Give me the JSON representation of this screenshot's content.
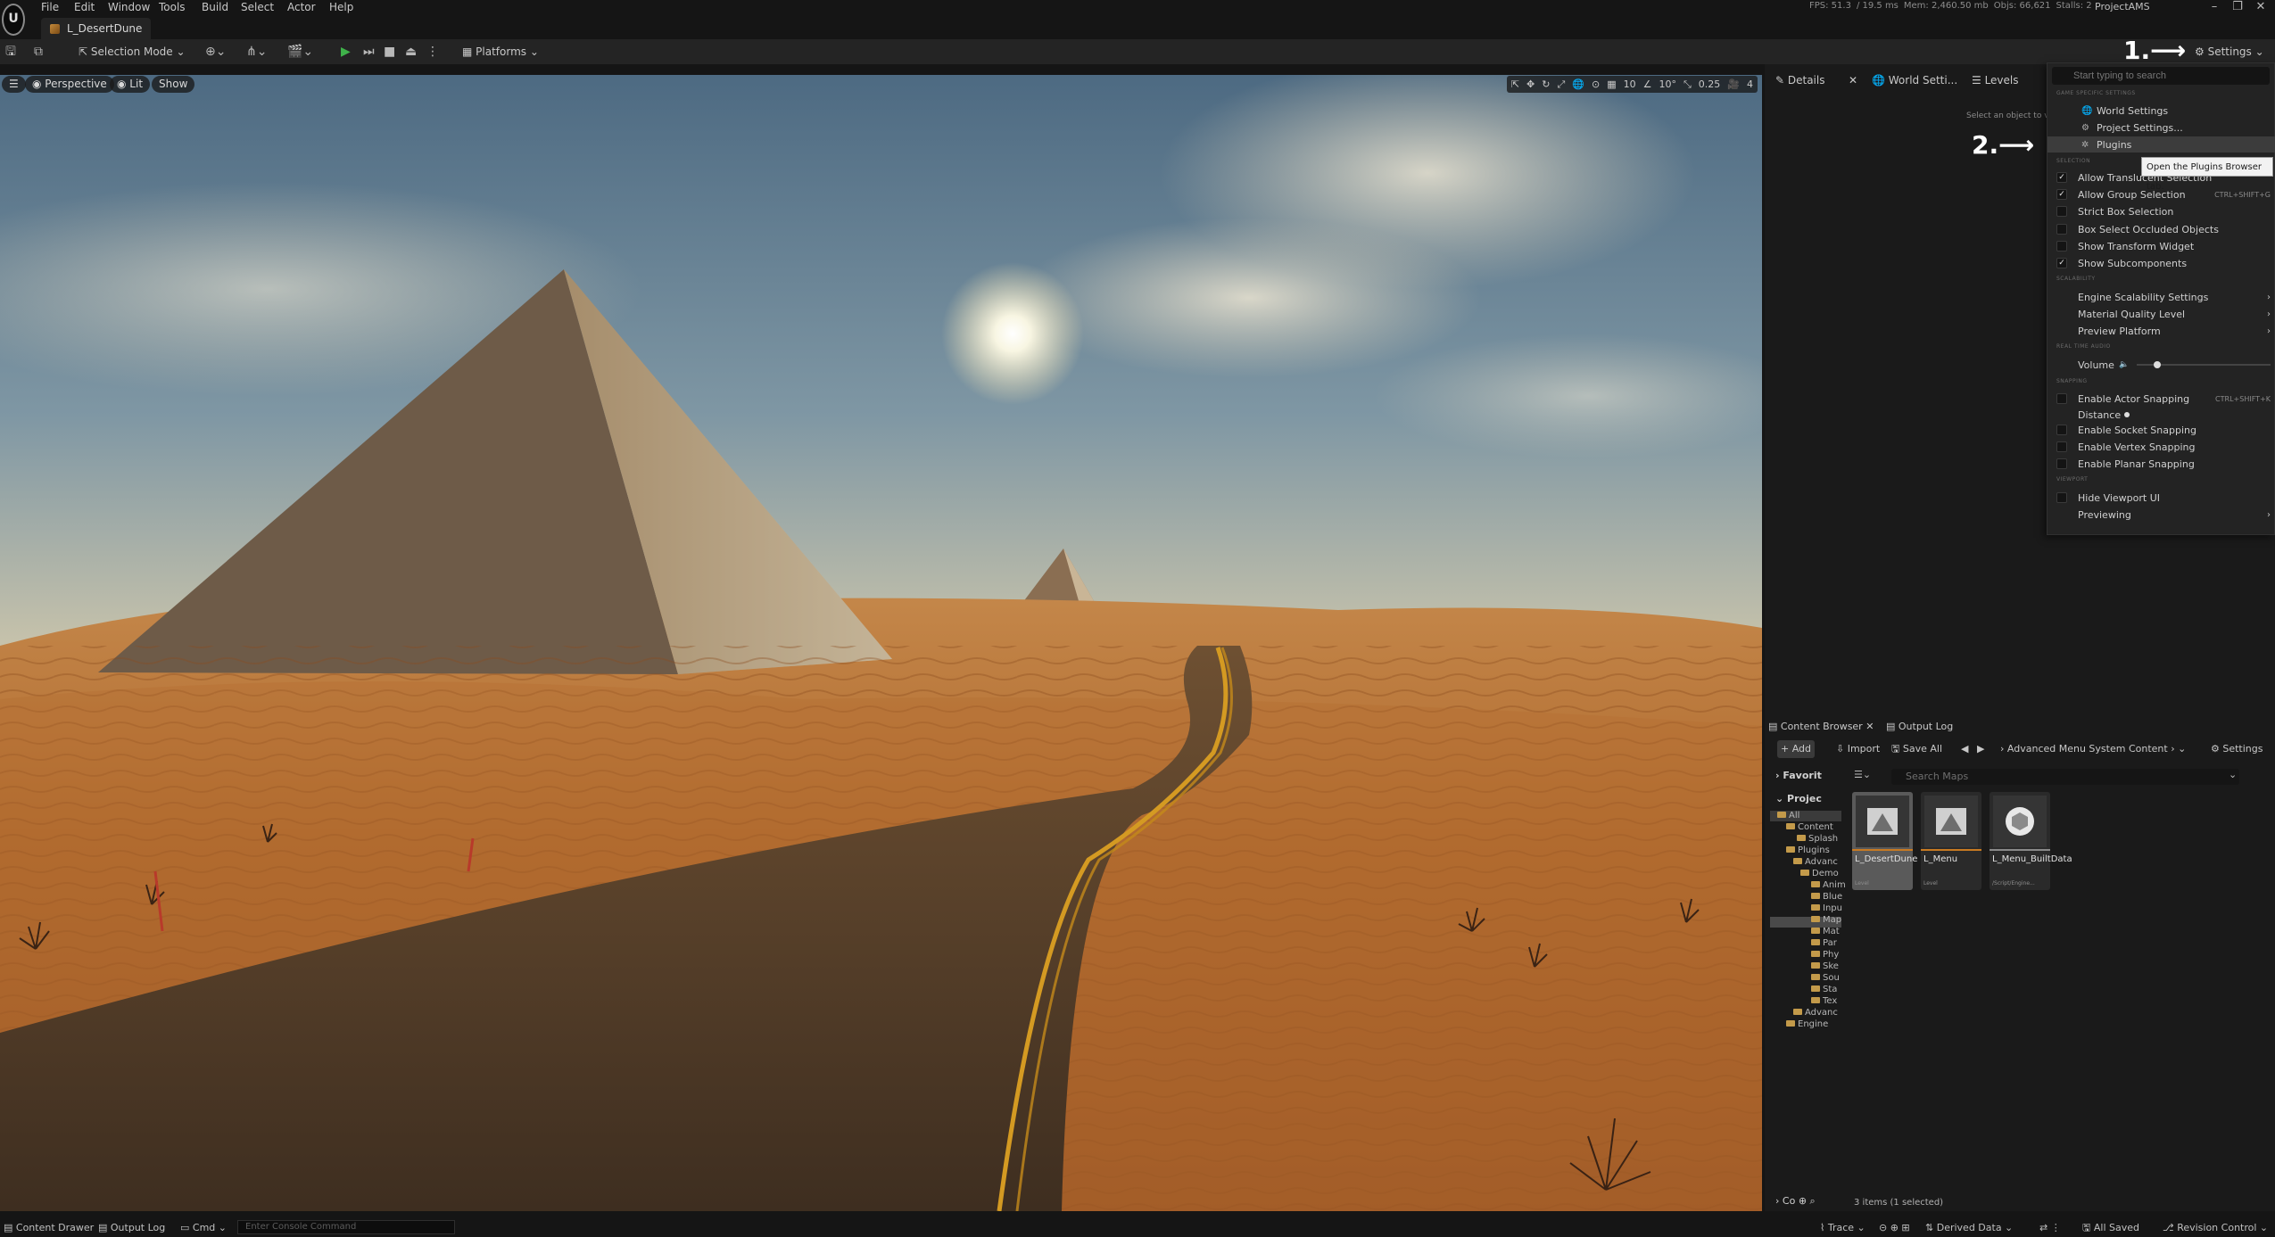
{
  "app": {
    "logo_label": "U",
    "menus": [
      "File",
      "Edit",
      "Window",
      "Tools",
      "Build",
      "Select",
      "Actor",
      "Help"
    ],
    "level_tab": "L_DesertDune",
    "project": "ProjectAMS",
    "stats": {
      "fps": "FPS: 51.3",
      "frame_ms": "/ 19.5 ms",
      "mem": "Mem: 2,460.50 mb",
      "objs": "Objs: 66,621",
      "stalls": "Stalls: 2"
    }
  },
  "toolbar": {
    "selection_mode": "Selection Mode",
    "platforms": "Platforms",
    "settings": "Settings"
  },
  "viewport": {
    "perspective": "Perspective",
    "lit": "Lit",
    "show": "Show",
    "grid_snap": "10",
    "rotation_snap": "10°",
    "scale_snap": "0.25",
    "camera_speed": "4"
  },
  "right_panel": {
    "tabs": [
      "Details",
      "World Setti...",
      "Levels"
    ],
    "details_hint": "Select an object to vie"
  },
  "annotations": {
    "step1": "1.",
    "step2": "2."
  },
  "settings_menu": {
    "search_placeholder": "Start typing to search",
    "sections": {
      "game_specific": "GAME SPECIFIC SETTINGS",
      "selection": "SELECTION",
      "scalability": "SCALABILITY",
      "real_time_audio": "REAL TIME AUDIO",
      "snapping": "SNAPPING",
      "viewport": "VIEWPORT"
    },
    "world_settings": "World Settings",
    "project_settings": "Project Settings...",
    "plugins": "Plugins",
    "tooltip": "Open the Plugins Browser tab.",
    "allow_translucent": "Allow Translucent Selection",
    "allow_group": "Allow Group Selection",
    "allow_group_shortcut": "CTRL+SHIFT+G",
    "strict_box": "Strict Box Selection",
    "box_occluded": "Box Select Occluded Objects",
    "show_transform": "Show Transform Widget",
    "show_subcomponents": "Show Subcomponents",
    "engine_scalability": "Engine Scalability Settings",
    "material_quality": "Material Quality Level",
    "preview_platform": "Preview Platform",
    "volume": "Volume",
    "volume_level": 0.15,
    "enable_actor_snapping": "Enable Actor Snapping",
    "actor_snap_shortcut": "CTRL+SHIFT+K",
    "distance": "Distance",
    "enable_socket": "Enable Socket Snapping",
    "enable_vertex": "Enable Vertex Snapping",
    "enable_planar": "Enable Planar Snapping",
    "hide_viewport_ui": "Hide Viewport UI",
    "previewing": "Previewing"
  },
  "content_browser": {
    "tabs": [
      "Content Browser",
      "Output Log"
    ],
    "add": "+ Add",
    "import": "Import",
    "save_all": "Save All",
    "breadcrumb": "Advanced Menu System Content",
    "settings": "Settings",
    "search_placeholder": "Search Maps",
    "favorites": "Favorit",
    "project": "Projec",
    "tree": [
      "All",
      "Content",
      "Splash",
      "Plugins",
      "Advanc",
      "Demo",
      "Anim",
      "Blue",
      "Inpu",
      "Map",
      "Mat",
      "Par",
      "Phy",
      "Ske",
      "Sou",
      "Sta",
      "Tex",
      "Advanc",
      "Engine"
    ],
    "collections": "Co",
    "assets": [
      {
        "name": "L_DesertDune",
        "type": "Level"
      },
      {
        "name": "L_Menu",
        "type": "Level"
      },
      {
        "name": "L_Menu_BuiltData",
        "type": "/Script/Engine..."
      }
    ],
    "status": "3 items (1 selected)"
  },
  "statusbar": {
    "content_drawer": "Content Drawer",
    "output_log": "Output Log",
    "cmd": "Cmd",
    "console_placeholder": "Enter Console Command",
    "trace": "Trace",
    "derived_data": "Derived Data",
    "all_saved": "All Saved",
    "revision_control": "Revision Control"
  },
  "colors": {
    "accent_orange": "#c87a22",
    "play_green": "#3fb24a",
    "panel_bg": "#1a1a1a"
  }
}
